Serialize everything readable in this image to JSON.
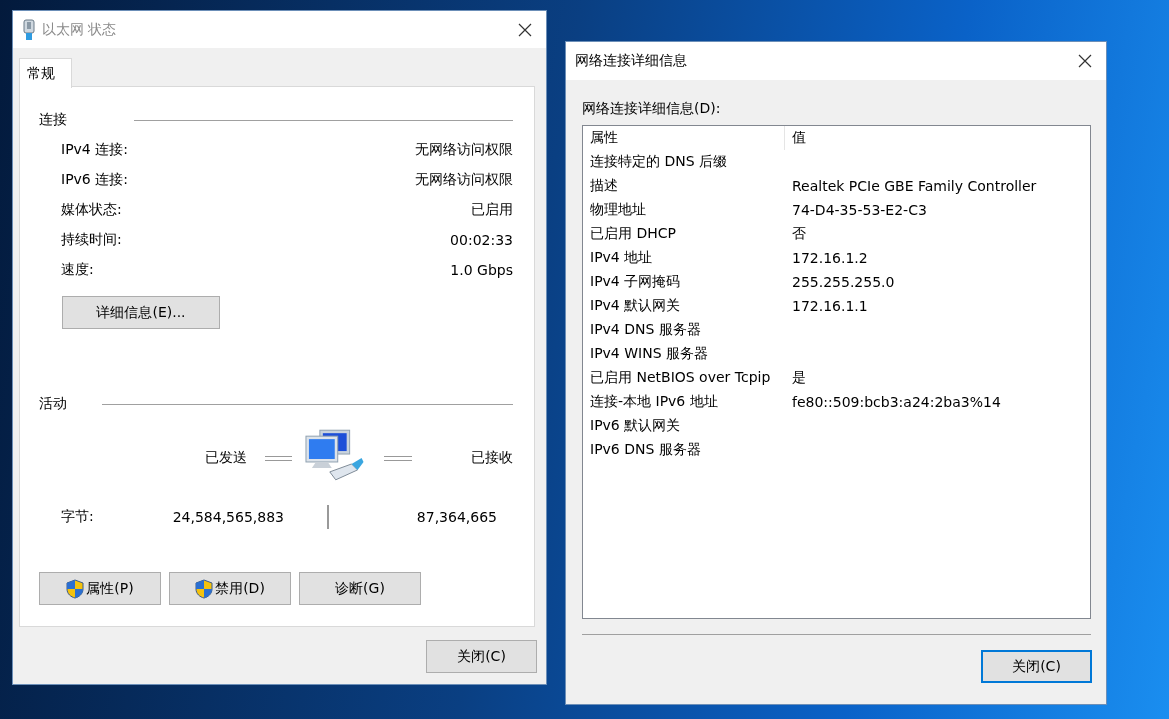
{
  "status_window": {
    "title": "以太网 状态",
    "active": false,
    "tabs": [
      {
        "label": "常规",
        "selected": true
      }
    ],
    "connection": {
      "heading": "连接",
      "rows": [
        {
          "label": "IPv4 连接:",
          "value": "无网络访问权限"
        },
        {
          "label": "IPv6 连接:",
          "value": "无网络访问权限"
        },
        {
          "label": "媒体状态:",
          "value": "已启用"
        },
        {
          "label": "持续时间:",
          "value": "00:02:33"
        },
        {
          "label": "速度:",
          "value": "1.0 Gbps"
        }
      ]
    },
    "details_button": "详细信息(E)...",
    "activity": {
      "heading": "活动",
      "sent_label": "已发送",
      "received_label": "已接收",
      "bytes_label": "字节:",
      "bytes_sent": "24,584,565,883",
      "bytes_received": "87,364,665"
    },
    "action_buttons": [
      {
        "label": "属性(P)",
        "shield": true
      },
      {
        "label": "禁用(D)",
        "shield": true
      },
      {
        "label": "诊断(G)",
        "shield": false
      }
    ],
    "close_button": {
      "label": "关闭(C)",
      "default": false
    }
  },
  "details_window": {
    "title": "网络连接详细信息",
    "active": true,
    "list_label": "网络连接详细信息(D):",
    "columns": [
      "属性",
      "值"
    ],
    "rows": [
      {
        "property": "连接特定的 DNS 后缀"
      },
      {
        "property": "描述",
        "value": "Realtek PCIe GBE Family Controller"
      },
      {
        "property": "物理地址",
        "value": "74-D4-35-53-E2-C3"
      },
      {
        "property": "已启用 DHCP",
        "value": "否"
      },
      {
        "property": "IPv4 地址",
        "value": "172.16.1.2"
      },
      {
        "property": "IPv4 子网掩码",
        "value": "255.255.255.0"
      },
      {
        "property": "IPv4 默认网关",
        "value": "172.16.1.1"
      },
      {
        "property": "IPv4 DNS 服务器"
      },
      {
        "property": "IPv4 WINS 服务器"
      },
      {
        "property": "已启用 NetBIOS over Tcpip",
        "value": "是"
      },
      {
        "property": "连接-本地 IPv6 地址",
        "value": "fe80::509:bcb3:a24:2ba3%14"
      },
      {
        "property": "IPv6 默认网关"
      },
      {
        "property": "IPv6 DNS 服务器"
      }
    ],
    "close_button": {
      "label": "关闭(C)",
      "default": true
    }
  }
}
